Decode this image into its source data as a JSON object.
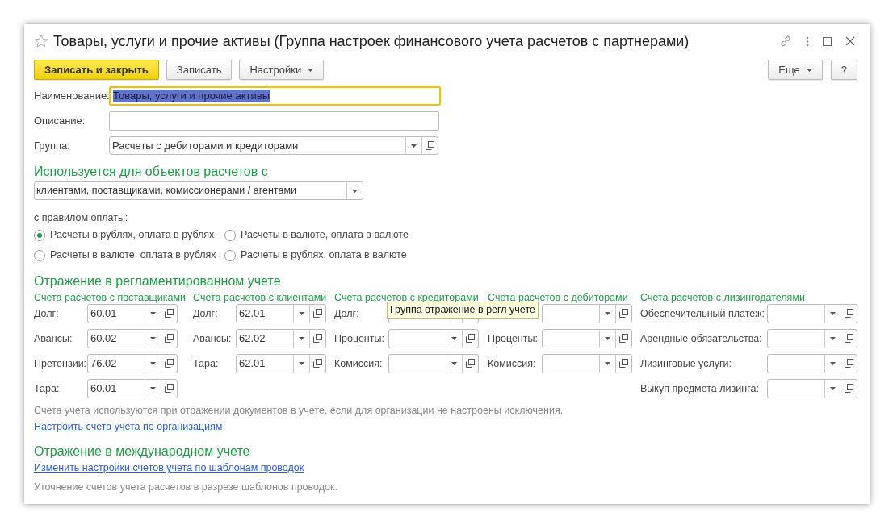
{
  "window": {
    "title": "Товары, услуги и прочие активы (Группа настроек финансового учета расчетов с партнерами)"
  },
  "toolbar": {
    "buttons": [
      {
        "label": "Записать и закрыть",
        "kind": "primary"
      },
      {
        "label": "Записать",
        "kind": "plain"
      },
      {
        "label": "Настройки",
        "kind": "menu"
      }
    ],
    "right_buttons": [
      {
        "label": "Еще",
        "kind": "menu"
      },
      {
        "label": "?",
        "kind": "plain"
      }
    ]
  },
  "fields": [
    {
      "label": "Наименование:",
      "value": "Товары, услуги и прочие активы",
      "kind": "text",
      "focused": true
    },
    {
      "label": "Описание:",
      "kind": "text",
      "focused": false
    },
    {
      "label": "Группа:",
      "value": "Расчеты с дебиторами и кредиторами",
      "kind": "select",
      "focused": false
    }
  ],
  "usage": {
    "title": "Используется для объектов расчетов с",
    "value": "клиентами, поставщиками, комиссионерами / агентами",
    "payment_label": "с правилом оплаты:",
    "options": [
      {
        "label": "Расчеты в рублях, оплата в рублях",
        "selected": true
      },
      {
        "label": "Расчеты в валюте, оплата в валюте",
        "selected": false
      },
      {
        "label": "Расчеты в валюте, оплата в рублях",
        "selected": false
      },
      {
        "label": "Расчеты в рублях, оплата в валюте",
        "selected": false
      }
    ]
  },
  "regulated": {
    "title": "Отражение в регламентированном учете",
    "columns": [
      {
        "title": "Счета расчетов с поставщиками",
        "rows": [
          {
            "label": "Долг:",
            "value": "60.01"
          },
          {
            "label": "Авансы:",
            "value": "60.02"
          },
          {
            "label": "Претензии:",
            "value": "76.02"
          },
          {
            "label": "Тара:",
            "value": "60.01"
          }
        ]
      },
      {
        "title": "Счета расчетов с клиентами",
        "rows": [
          {
            "label": "Долг:",
            "value": "62.01"
          },
          {
            "label": "Авансы:",
            "value": "62.02"
          },
          {
            "label": "Тара:",
            "value": "62.01"
          }
        ]
      },
      {
        "title": "Счета расчетов с кредиторами",
        "rows": [
          {
            "label": "Долг:"
          },
          {
            "label": "Проценты:"
          },
          {
            "label": "Комиссия:"
          }
        ]
      },
      {
        "title": "Счета расчетов с дебиторами",
        "rows": [
          {},
          {
            "label": "Проценты:"
          },
          {
            "label": "Комиссия:"
          }
        ]
      },
      {
        "title": "Счета  расчетов с лизингодателями",
        "rows": [
          {
            "label": "Обеспечительный платеж:"
          },
          {
            "label": "Арендные обязательства:"
          },
          {
            "label": "Лизинговые услуги:"
          },
          {
            "label": "Выкуп предмета лизинга:"
          }
        ]
      }
    ],
    "tooltip": "Группа отражение в регл учете",
    "note": "Счета учета используются при отражении документов в учете, если для организации не настроены исключения.",
    "link": "Настроить счета учета по организациям"
  },
  "international": {
    "title": "Отражение в международном учете",
    "link": "Изменить настройки счетов учета по шаблонам проводок",
    "note": "Уточнение счетов учета расчетов в разрезе шаблонов проводок."
  }
}
